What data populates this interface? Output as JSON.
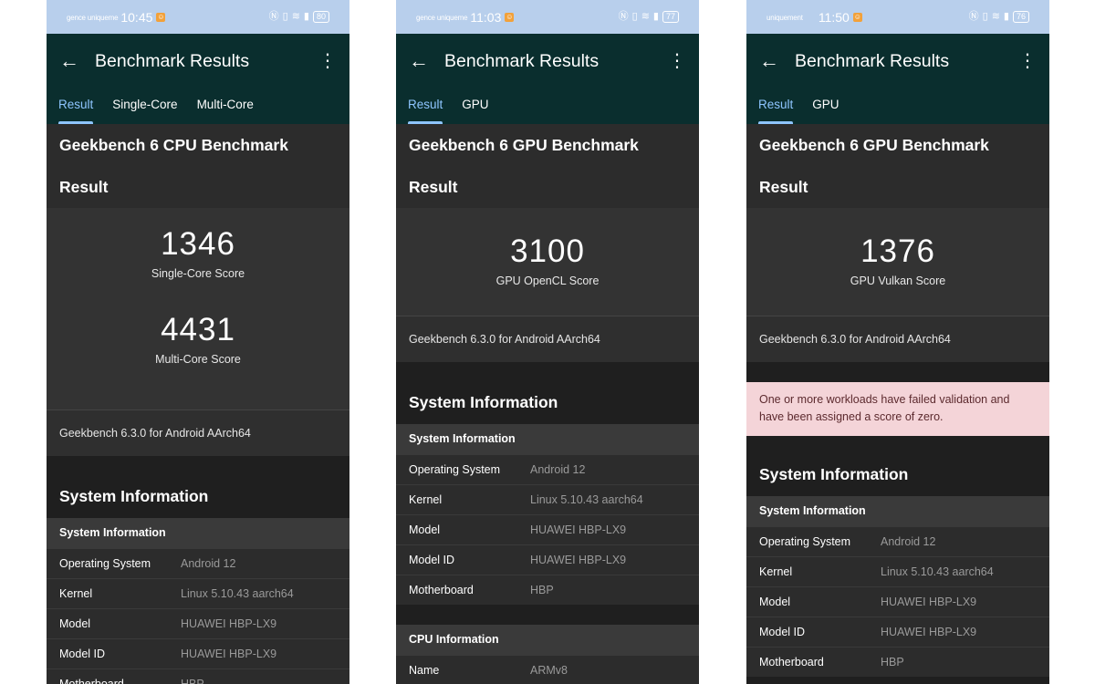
{
  "phones": [
    {
      "status": {
        "carrier": "gence uniqueme",
        "time": "10:45",
        "battery": "80"
      },
      "title": "Benchmark Results",
      "tabs": [
        "Result",
        "Single-Core",
        "Multi-Core"
      ],
      "bench_title": "Geekbench 6 CPU Benchmark",
      "result_heading": "Result",
      "scores": [
        {
          "value": "1346",
          "label": "Single-Core Score"
        },
        {
          "value": "4431",
          "label": "Multi-Core Score"
        }
      ],
      "version": "Geekbench 6.3.0 for Android AArch64",
      "sysinfo_title": "System Information",
      "table_header": "System Information",
      "rows": [
        {
          "key": "Operating System",
          "value": "Android 12"
        },
        {
          "key": "Kernel",
          "value": "Linux 5.10.43 aarch64"
        },
        {
          "key": "Model",
          "value": "HUAWEI HBP-LX9"
        },
        {
          "key": "Model ID",
          "value": "HUAWEI HBP-LX9"
        },
        {
          "key": "Motherboard",
          "value": "HBP"
        }
      ]
    },
    {
      "status": {
        "carrier": "gence uniqueme",
        "time": "11:03",
        "battery": "77"
      },
      "title": "Benchmark Results",
      "tabs": [
        "Result",
        "GPU"
      ],
      "bench_title": "Geekbench 6 GPU Benchmark",
      "result_heading": "Result",
      "scores": [
        {
          "value": "3100",
          "label": "GPU OpenCL Score"
        }
      ],
      "version": "Geekbench 6.3.0 for Android AArch64",
      "sysinfo_title": "System Information",
      "table_header": "System Information",
      "rows": [
        {
          "key": "Operating System",
          "value": "Android 12"
        },
        {
          "key": "Kernel",
          "value": "Linux 5.10.43 aarch64"
        },
        {
          "key": "Model",
          "value": "HUAWEI HBP-LX9"
        },
        {
          "key": "Model ID",
          "value": "HUAWEI HBP-LX9"
        },
        {
          "key": "Motherboard",
          "value": "HBP"
        }
      ],
      "cpu_header": "CPU Information",
      "cpu_rows": [
        {
          "key": "Name",
          "value": "ARMv8"
        }
      ]
    },
    {
      "status": {
        "carrier": "uniquement",
        "time": "11:50",
        "battery": "76"
      },
      "title": "Benchmark Results",
      "tabs": [
        "Result",
        "GPU"
      ],
      "bench_title": "Geekbench 6 GPU Benchmark",
      "result_heading": "Result",
      "scores": [
        {
          "value": "1376",
          "label": "GPU Vulkan Score"
        }
      ],
      "version": "Geekbench 6.3.0 for Android AArch64",
      "warning": "One or more workloads have failed validation and have been assigned a score of zero.",
      "sysinfo_title": "System Information",
      "table_header": "System Information",
      "rows": [
        {
          "key": "Operating System",
          "value": "Android 12"
        },
        {
          "key": "Kernel",
          "value": "Linux 5.10.43 aarch64"
        },
        {
          "key": "Model",
          "value": "HUAWEI HBP-LX9"
        },
        {
          "key": "Model ID",
          "value": "HUAWEI HBP-LX9"
        },
        {
          "key": "Motherboard",
          "value": "HBP"
        }
      ]
    }
  ]
}
